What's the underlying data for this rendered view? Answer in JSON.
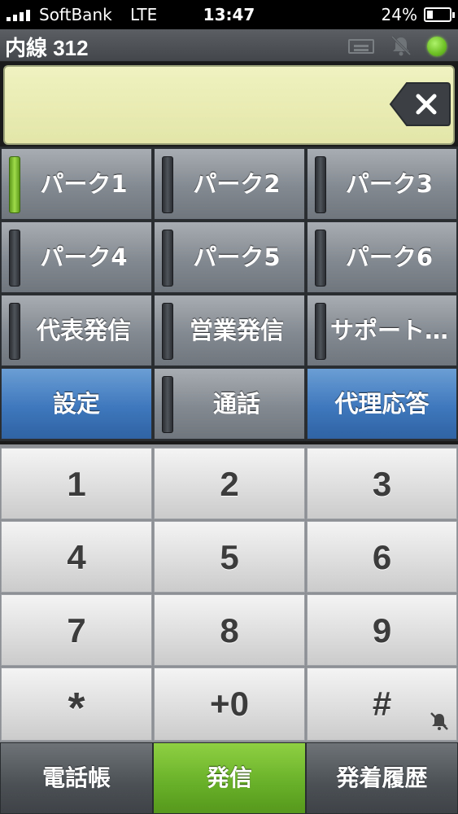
{
  "status_bar": {
    "carrier": "SoftBank",
    "network": "LTE",
    "time": "13:47",
    "battery_percent": "24%",
    "battery_level": 0.24,
    "signal_bars": 4
  },
  "header": {
    "title": "内線 312",
    "status_led_color": "#6cbf24"
  },
  "display": {
    "number": ""
  },
  "function_keys": [
    {
      "label": "パーク1",
      "lamp": "on"
    },
    {
      "label": "パーク2",
      "lamp": "off"
    },
    {
      "label": "パーク3",
      "lamp": "off"
    },
    {
      "label": "パーク4",
      "lamp": "off"
    },
    {
      "label": "パーク5",
      "lamp": "off"
    },
    {
      "label": "パーク6",
      "lamp": "off"
    },
    {
      "label": "代表発信",
      "lamp": "off"
    },
    {
      "label": "営業発信",
      "lamp": "off"
    },
    {
      "label": "サポート…",
      "lamp": "off"
    },
    {
      "label": "設定",
      "lamp": "none",
      "color": "#3f78bd"
    },
    {
      "label": "通話",
      "lamp": "off"
    },
    {
      "label": "代理応答",
      "lamp": "none",
      "color": "#3f78bd"
    }
  ],
  "keypad": [
    "1",
    "2",
    "3",
    "4",
    "5",
    "6",
    "7",
    "8",
    "9",
    "*",
    "+0",
    "#"
  ],
  "bottom_bar": {
    "phonebook": "電話帳",
    "call": "発信",
    "history": "発着履歴",
    "call_color": "#6ab22a"
  },
  "icons": {
    "keyboard": "keyboard-icon",
    "mute": "bell-slash-icon",
    "backspace": "backspace-icon",
    "status": "status-led-icon"
  }
}
